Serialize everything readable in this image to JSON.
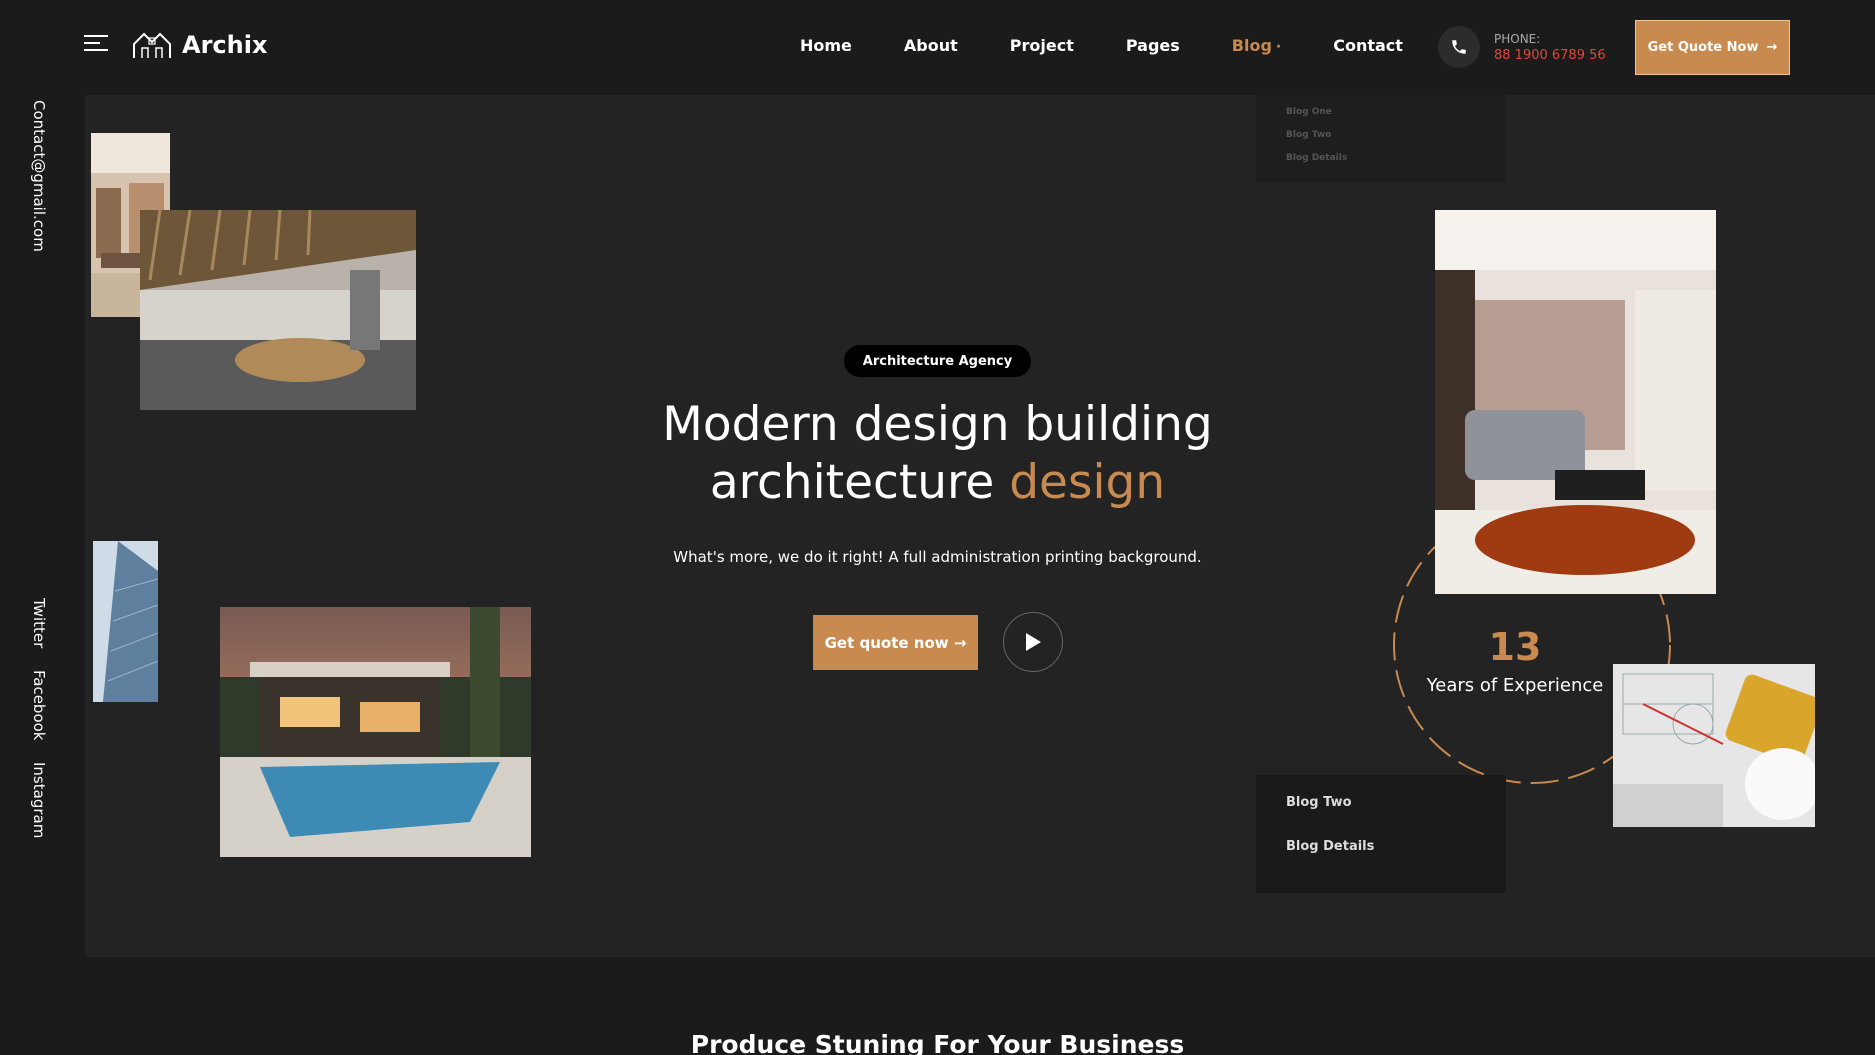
{
  "brand": {
    "name": "Archix"
  },
  "nav": {
    "items": [
      {
        "label": "Home"
      },
      {
        "label": "About"
      },
      {
        "label": "Project"
      },
      {
        "label": "Pages"
      },
      {
        "label": "Blog"
      },
      {
        "label": "Contact"
      }
    ],
    "active": "Blog"
  },
  "phone": {
    "label": "PHONE:",
    "number": "88 1900 6789 56"
  },
  "header_cta": {
    "label": "Get Quote Now",
    "icon": "arrow-right-icon"
  },
  "sidebar": {
    "email": "Contact@gmail.com",
    "socials": [
      "Twitter",
      "Facebook",
      "Instagram"
    ]
  },
  "hero": {
    "badge": "Architecture Agency",
    "title_line1": "Modern design building",
    "title_line2_plain": "architecture",
    "title_line2_accent": "design",
    "subtitle": "What's more, we do it right! A full administration printing background.",
    "cta_label": "Get quote now →",
    "play_icon": "play-icon"
  },
  "dropdown_top": {
    "items": [
      "Blog One",
      "Blog Two",
      "Blog Details"
    ]
  },
  "dropdown_bottom": {
    "items": [
      "Blog Two",
      "Blog Details"
    ]
  },
  "experience": {
    "number": "13",
    "label": "Years of Experience"
  },
  "section": {
    "heading": "Produce Stuning For Your Business"
  },
  "colors": {
    "accent": "#c98a50",
    "background": "#1b1b1b",
    "panel": "#232323",
    "phone_number": "#e0483a"
  }
}
